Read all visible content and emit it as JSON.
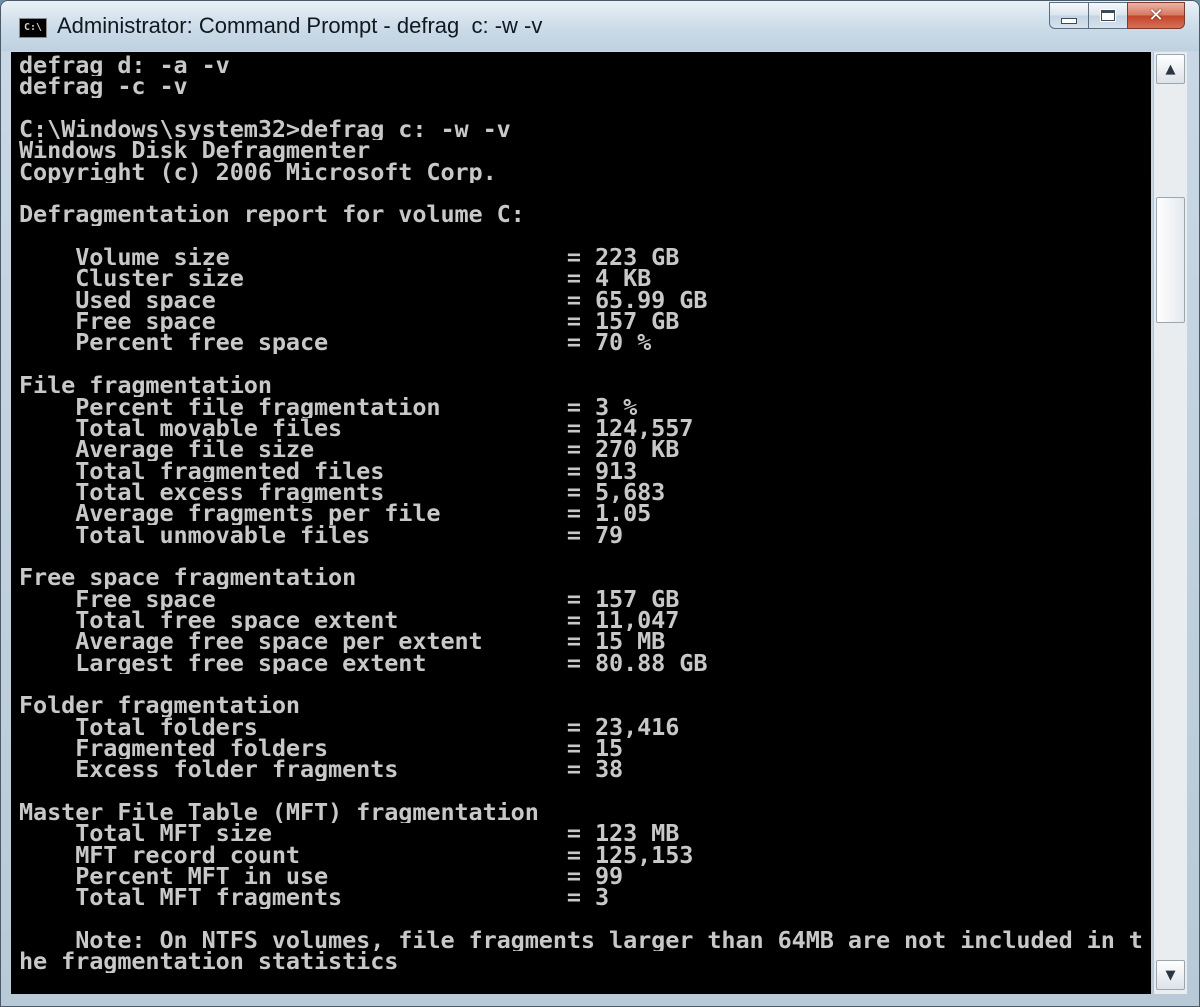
{
  "window": {
    "title": "Administrator: Command Prompt - defrag  c: -w -v",
    "icon_text": "C:\\",
    "controls": {
      "minimize": "minimize",
      "maximize": "maximize",
      "close": "close"
    }
  },
  "console": {
    "lines": [
      "defrag d: -a -v",
      "defrag -c -v",
      "",
      "C:\\Windows\\system32>defrag c: -w -v",
      "Windows Disk Defragmenter",
      "Copyright (c) 2006 Microsoft Corp.",
      "",
      "Defragmentation report for volume C:",
      "",
      "    Volume size                        = 223 GB",
      "    Cluster size                       = 4 KB",
      "    Used space                         = 65.99 GB",
      "    Free space                         = 157 GB",
      "    Percent free space                 = 70 %",
      "",
      "File fragmentation",
      "    Percent file fragmentation         = 3 %",
      "    Total movable files                = 124,557",
      "    Average file size                  = 270 KB",
      "    Total fragmented files             = 913",
      "    Total excess fragments             = 5,683",
      "    Average fragments per file         = 1.05",
      "    Total unmovable files              = 79",
      "",
      "Free space fragmentation",
      "    Free space                         = 157 GB",
      "    Total free space extent            = 11,047",
      "    Average free space per extent      = 15 MB",
      "    Largest free space extent          = 80.88 GB",
      "",
      "Folder fragmentation",
      "    Total folders                      = 23,416",
      "    Fragmented folders                 = 15",
      "    Excess folder fragments            = 38",
      "",
      "Master File Table (MFT) fragmentation",
      "    Total MFT size                     = 123 MB",
      "    MFT record count                   = 125,153",
      "    Percent MFT in use                 = 99",
      "    Total MFT fragments                = 3",
      "",
      "    Note: On NTFS volumes, file fragments larger than 64MB are not included in t",
      "he fragmentation statistics"
    ]
  },
  "scrollbar": {
    "up_arrow": "▲",
    "down_arrow": "▼"
  }
}
